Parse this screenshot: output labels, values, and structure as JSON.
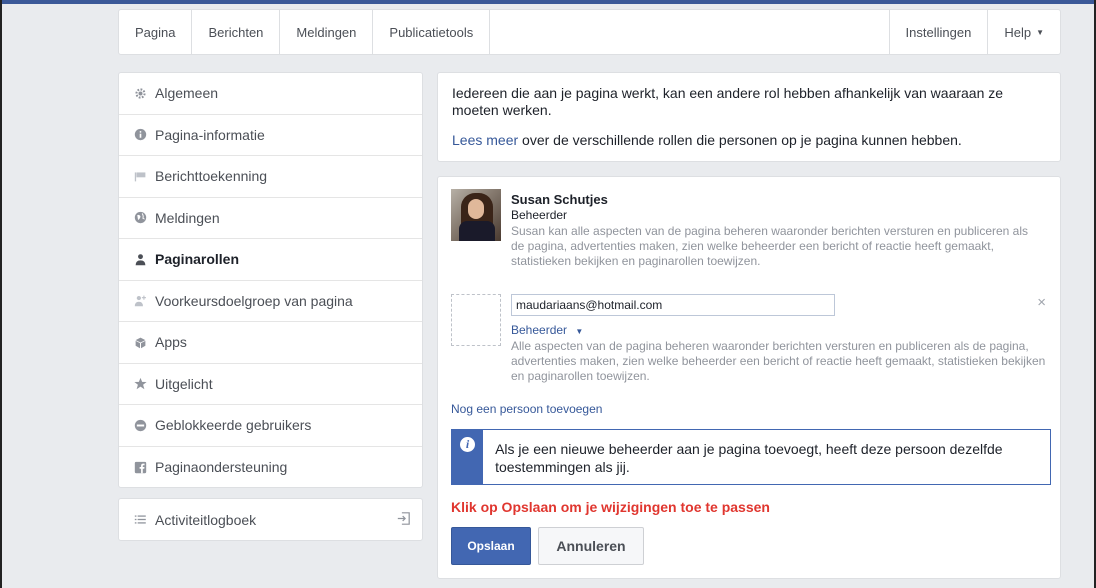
{
  "topnav": {
    "left_items": [
      "Pagina",
      "Berichten",
      "Meldingen",
      "Publicatietools"
    ],
    "settings_label": "Instellingen",
    "help_label": "Help"
  },
  "sidebar": {
    "items": [
      {
        "label": "Algemeen",
        "icon": "gear-icon"
      },
      {
        "label": "Pagina-informatie",
        "icon": "info-icon"
      },
      {
        "label": "Berichttoekenning",
        "icon": "flag-icon"
      },
      {
        "label": "Meldingen",
        "icon": "globe-icon"
      },
      {
        "label": "Paginarollen",
        "icon": "person-icon",
        "active": true
      },
      {
        "label": "Voorkeursdoelgroep van pagina",
        "icon": "person-plus-icon"
      },
      {
        "label": "Apps",
        "icon": "box-icon"
      },
      {
        "label": "Uitgelicht",
        "icon": "star-icon"
      },
      {
        "label": "Geblokkeerde gebruikers",
        "icon": "blocked-icon"
      },
      {
        "label": "Paginaondersteuning",
        "icon": "facebook-icon"
      }
    ]
  },
  "activity_log": {
    "label": "Activiteitlogboek"
  },
  "info": {
    "text1": "Iedereen die aan je pagina werkt, kan een andere rol hebben afhankelijk van waaraan ze moeten werken.",
    "link": "Lees meer",
    "text2": " over de verschillende rollen die personen op je pagina kunnen hebben."
  },
  "user": {
    "name": "Susan Schutjes",
    "role": "Beheerder",
    "desc": "Susan kan alle aspecten van de pagina beheren waaronder berichten versturen en publiceren als de pagina, advertenties maken, zien welke beheerder een bericht of reactie heeft gemaakt, statistieken bekijken en paginarollen toewijzen."
  },
  "new_person": {
    "email": "maudariaans@hotmail.com",
    "role": "Beheerder",
    "role_desc": "Alle aspecten van de pagina beheren waaronder berichten versturen en publiceren als de pagina, advertenties maken, zien welke beheerder een bericht of reactie heeft gemaakt, statistieken bekijken en paginarollen toewijzen.",
    "close_symbol": "×"
  },
  "add_person_label": "Nog een persoon toevoegen",
  "notice": {
    "text": "Als je een nieuwe beheerder aan je pagina toevoegt, heeft deze persoon dezelfde toestemmingen als jij."
  },
  "warning": "Klik op Opslaan om je wijzigingen toe te passen",
  "buttons": {
    "save": "Opslaan",
    "cancel": "Annuleren"
  },
  "colors": {
    "brand": "#4267b2",
    "link": "#365899",
    "warning": "#e0362f"
  }
}
